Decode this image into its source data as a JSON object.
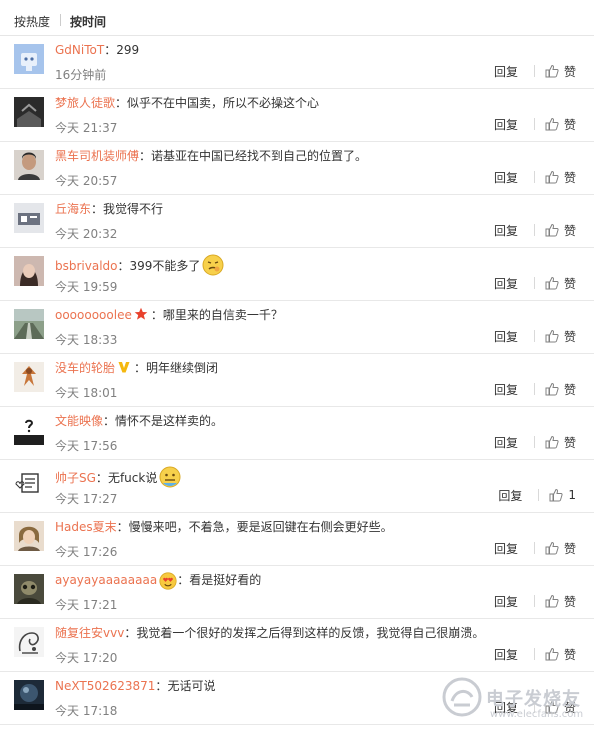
{
  "sort": {
    "hot_label": "按热度",
    "time_label": "按时间"
  },
  "comments": [
    {
      "user": "GdNiToT",
      "colon": "：",
      "text": "299",
      "time": "16分钟前",
      "reply": "回复",
      "like": "赞"
    },
    {
      "user": "梦旅人徒歌",
      "colon": "：",
      "text": "似乎不在中国卖，所以不必操这个心",
      "time": "今天 21:37",
      "reply": "回复",
      "like": "赞"
    },
    {
      "user": "黑车司机装师傅",
      "colon": "：",
      "text": "诺基亚在中国已经找不到自己的位置了。",
      "time": "今天 20:57",
      "reply": "回复",
      "like": "赞"
    },
    {
      "user": "丘海东",
      "colon": "：",
      "text": "我觉得不行",
      "time": "今天 20:32",
      "reply": "回复",
      "like": "赞"
    },
    {
      "user": "bsbrivaldo",
      "colon": "：",
      "text": "399不能多了",
      "time": "今天 19:59",
      "reply": "回复",
      "like": "赞"
    },
    {
      "user": "oooooooolee",
      "colon": "：",
      "text": "哪里来的自信卖一千？",
      "time": "今天 18:33",
      "reply": "回复",
      "like": "赞"
    },
    {
      "user": "没车的轮胎",
      "colon": "：",
      "text": "明年继续倒闭",
      "time": "今天 18:01",
      "reply": "回复",
      "like": "赞"
    },
    {
      "user": "文能映像",
      "colon": "：",
      "text": "情怀不是这样卖的。",
      "time": "今天 17:56",
      "reply": "回复",
      "like": "赞"
    },
    {
      "user": "帅子SG",
      "colon": "：",
      "text": "无fuck说",
      "time": "今天 17:27",
      "reply": "回复",
      "like": "1"
    },
    {
      "user": "Hades夏末",
      "colon": "：",
      "text": "慢慢来吧，不着急，要是返回键在右侧会更好些。",
      "time": "今天 17:26",
      "reply": "回复",
      "like": "赞"
    },
    {
      "user": "ayayayaaaaaaaa",
      "colon": "：",
      "text": "看是挺好看的",
      "time": "今天 17:21",
      "reply": "回复",
      "like": "赞"
    },
    {
      "user": "随复往安vvv",
      "colon": "：",
      "text": "我觉着一个很好的发挥之后得到这样的反馈，我觉得自己很崩溃。",
      "time": "今天 17:20",
      "reply": "回复",
      "like": "赞"
    },
    {
      "user": "NeXT502623871",
      "colon": "：",
      "text": "无话可说",
      "time": "今天 17:18",
      "reply": "回复",
      "like": "赞"
    }
  ],
  "watermark": {
    "text": "电子发烧友",
    "url": "www.elecfans.com"
  },
  "colors": {
    "username": "#eb7350",
    "text": "#333333",
    "time": "#808080",
    "divider": "#e8e8e8"
  }
}
